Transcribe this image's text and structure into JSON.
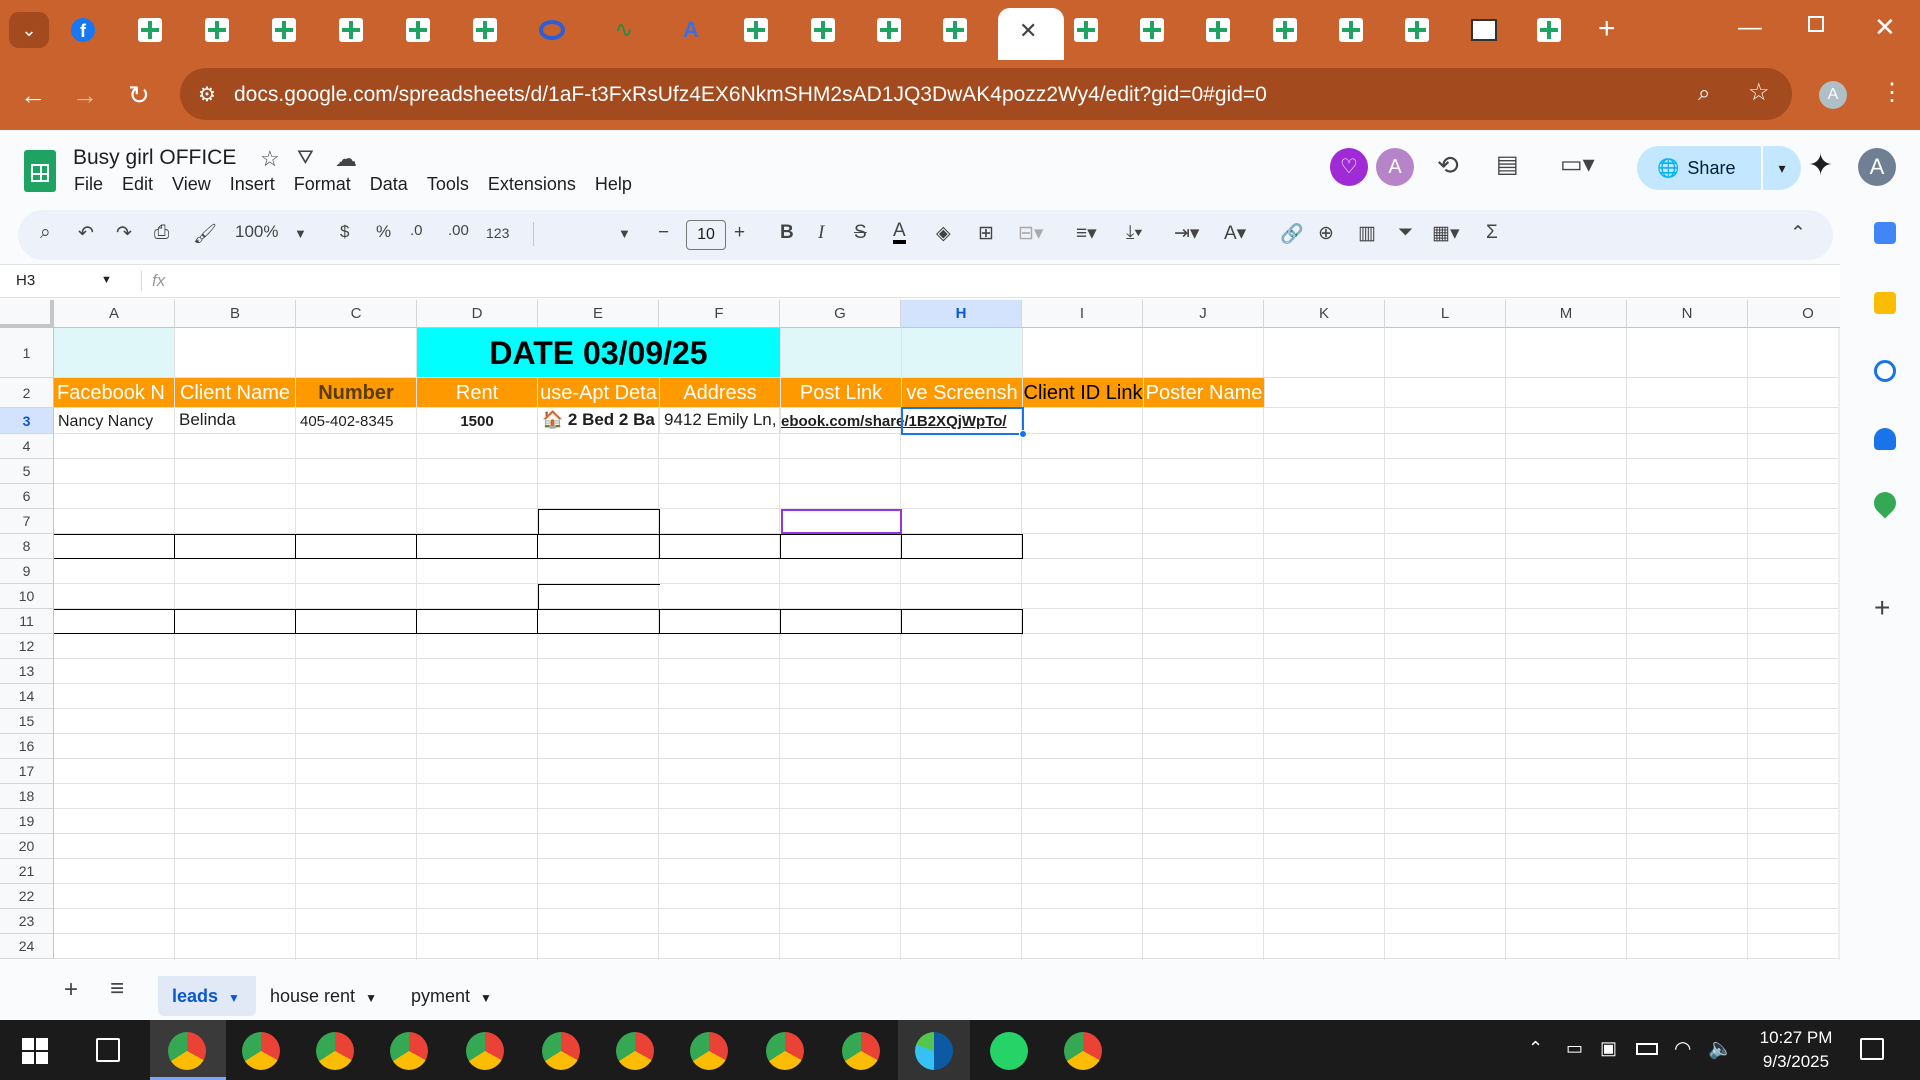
{
  "browser": {
    "url": "docs.google.com/spreadsheets/d/1aF-t3FxRsUfz4EX6NkmSHM2sAD1JQ3DwAK4pozz2Wy4/edit?gid=0#gid=0",
    "profile_initial": "A"
  },
  "doc": {
    "title": "Busy  girl OFFICE",
    "menu": [
      "File",
      "Edit",
      "View",
      "Insert",
      "Format",
      "Data",
      "Tools",
      "Extensions",
      "Help"
    ],
    "share_label": "Share",
    "account_initial": "A",
    "collab_initial": "A"
  },
  "toolbar": {
    "zoom": "100%",
    "currency": "$",
    "percent": "%",
    "dec_dec": ".0",
    "dec_inc": ".00",
    "number_format": "123",
    "font_size": "10"
  },
  "formula_bar": {
    "name_box": "H3",
    "fx": "fx"
  },
  "columns": [
    "A",
    "B",
    "C",
    "D",
    "E",
    "F",
    "G",
    "H",
    "I",
    "J",
    "K",
    "L",
    "M",
    "N",
    "O"
  ],
  "rows": [
    "1",
    "2",
    "3",
    "4",
    "5",
    "6",
    "7",
    "8",
    "9",
    "10",
    "11",
    "12",
    "13",
    "14",
    "15",
    "16",
    "17",
    "18",
    "19",
    "20",
    "21",
    "22",
    "23",
    "24"
  ],
  "sheet": {
    "date_banner": "DATE 03/09/25",
    "headers": [
      "Facebook N",
      "Client Name",
      "Number",
      "Rent",
      "use-Apt Deta",
      "Address",
      "Post Link",
      "ve Screensh",
      "Client ID Link",
      "Poster Name"
    ],
    "row3": {
      "a": "Nancy Nancy",
      "b": "Belinda",
      "c": "405-402-8345",
      "d": "1500",
      "e": "🏠 2 Bed 2 Ba",
      "f": "9412 Emily Ln,",
      "g": "ebook.com/share/1B2XQjWpTo/"
    }
  },
  "sheet_tabs": [
    "leads",
    "house rent",
    "pyment"
  ],
  "clock": {
    "time": "10:27 PM",
    "date": "9/3/2025"
  },
  "colors": {
    "chrome": "#c9622d",
    "header_orange": "#ff9900",
    "banner_cyan": "#00ffff",
    "light_cyan": "#e0f7fa"
  }
}
